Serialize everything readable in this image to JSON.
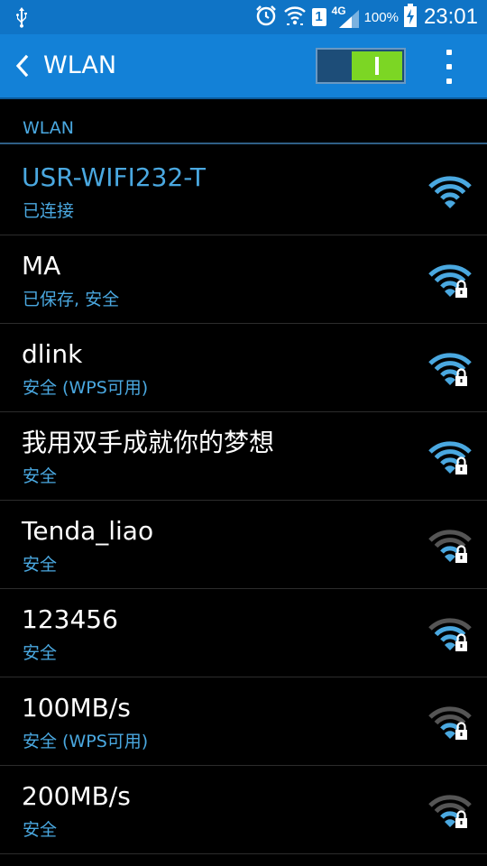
{
  "status_bar": {
    "sim_slot": "1",
    "network_type": "4G",
    "battery": "100%",
    "time": "23:01"
  },
  "action_bar": {
    "title": "WLAN",
    "toggle_state": "on"
  },
  "section": {
    "title": "WLAN"
  },
  "networks": [
    {
      "name": "USR-WIFI232-T",
      "status": "已连接",
      "connected": true,
      "secured": false,
      "signal": "strong"
    },
    {
      "name": "MA",
      "status": "已保存, 安全",
      "connected": false,
      "secured": true,
      "signal": "strong"
    },
    {
      "name": "dlink",
      "status": "安全 (WPS可用)",
      "connected": false,
      "secured": true,
      "signal": "strong"
    },
    {
      "name": "我用双手成就你的梦想",
      "status": "安全",
      "connected": false,
      "secured": true,
      "signal": "strong"
    },
    {
      "name": "Tenda_liao",
      "status": "安全",
      "connected": false,
      "secured": true,
      "signal": "weak"
    },
    {
      "name": "123456",
      "status": "安全",
      "connected": false,
      "secured": true,
      "signal": "medium"
    },
    {
      "name": "100MB/s",
      "status": "安全 (WPS可用)",
      "connected": false,
      "secured": true,
      "signal": "weak"
    },
    {
      "name": "200MB/s",
      "status": "安全",
      "connected": false,
      "secured": true,
      "signal": "weak"
    }
  ],
  "colors": {
    "accent": "#4aa8e0",
    "signal_dim": "#555555",
    "action_bar": "#1381d7",
    "status_bar": "#0f74c6"
  },
  "icons": {
    "status_bar": [
      "usb-icon",
      "alarm-icon",
      "wifi-status-icon",
      "sim-slot-icon",
      "cell-signal-icon",
      "battery-charging-icon"
    ],
    "action_bar": [
      "back-arrow-icon",
      "overflow-menu-icon"
    ],
    "network": [
      "wifi-signal-icon",
      "lock-icon"
    ]
  }
}
